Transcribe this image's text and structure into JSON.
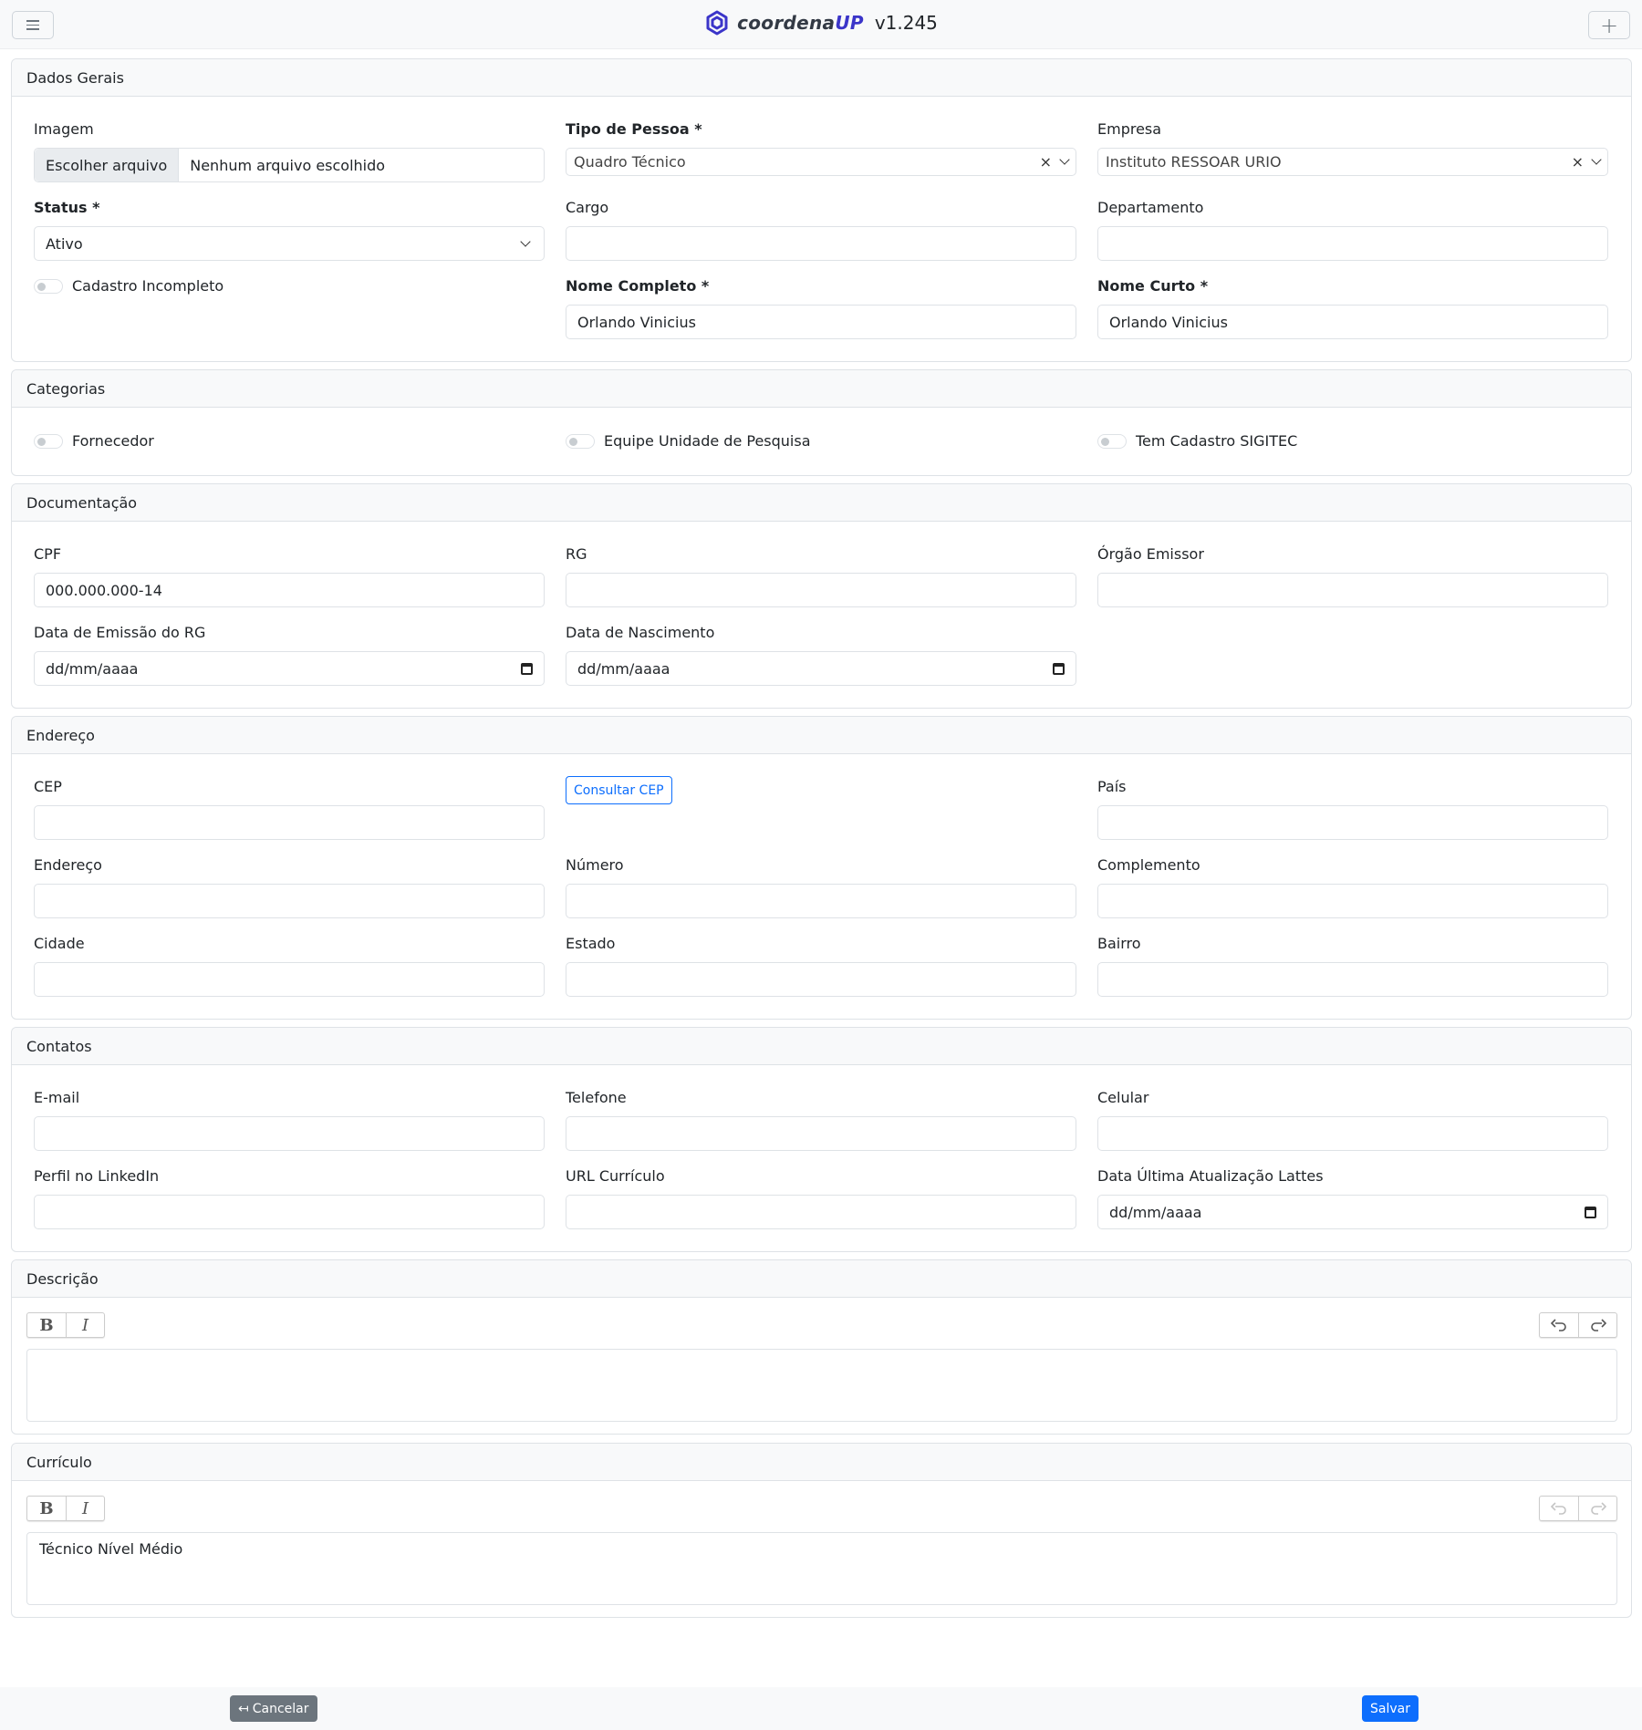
{
  "header": {
    "brand_name_prefix": "coordena",
    "brand_name_suffix": "UP",
    "version": "v1.245",
    "menu_icon": "hamburger-icon",
    "add_icon": "plus-icon",
    "add_label": "+"
  },
  "colors": {
    "brand": "#3b35c9",
    "primary": "#0d6efd",
    "secondary": "#6c757d"
  },
  "dados_gerais": {
    "title": "Dados Gerais",
    "imagem": {
      "label": "Imagem",
      "button": "Escolher arquivo",
      "value": "Nenhum arquivo escolhido"
    },
    "tipo_pessoa": {
      "label": "Tipo de Pessoa *",
      "value": "Quadro Técnico",
      "clear": "×"
    },
    "empresa": {
      "label": "Empresa",
      "value": "Instituto RESSOAR URIO",
      "clear": "×"
    },
    "status": {
      "label": "Status *",
      "value": "Ativo"
    },
    "cargo": {
      "label": "Cargo",
      "value": ""
    },
    "departamento": {
      "label": "Departamento",
      "value": ""
    },
    "cadastro_incompleto": {
      "label": "Cadastro Incompleto",
      "checked": false
    },
    "nome_completo": {
      "label": "Nome Completo *",
      "value": "Orlando Vinicius"
    },
    "nome_curto": {
      "label": "Nome Curto *",
      "value": "Orlando Vinicius"
    }
  },
  "categorias": {
    "title": "Categorias",
    "fornecedor": {
      "label": "Fornecedor",
      "checked": false
    },
    "equipe": {
      "label": "Equipe Unidade de Pesquisa",
      "checked": false
    },
    "sigitec": {
      "label": "Tem Cadastro SIGITEC",
      "checked": false
    }
  },
  "documentacao": {
    "title": "Documentação",
    "cpf": {
      "label": "CPF",
      "value": "000.000.000-14"
    },
    "rg": {
      "label": "RG",
      "value": ""
    },
    "orgao": {
      "label": "Órgão Emissor",
      "value": ""
    },
    "data_emissao": {
      "label": "Data de Emissão do RG",
      "value": "dd/mm/aaaa"
    },
    "data_nascimento": {
      "label": "Data de Nascimento",
      "value": "dd/mm/aaaa"
    }
  },
  "endereco": {
    "title": "Endereço",
    "cep": {
      "label": "CEP",
      "value": ""
    },
    "consultar": "Consultar CEP",
    "pais": {
      "label": "País",
      "value": ""
    },
    "endereco": {
      "label": "Endereço",
      "value": ""
    },
    "numero": {
      "label": "Número",
      "value": ""
    },
    "complemento": {
      "label": "Complemento",
      "value": ""
    },
    "cidade": {
      "label": "Cidade",
      "value": ""
    },
    "estado": {
      "label": "Estado",
      "value": ""
    },
    "bairro": {
      "label": "Bairro",
      "value": ""
    }
  },
  "contatos": {
    "title": "Contatos",
    "email": {
      "label": "E-mail",
      "value": ""
    },
    "telefone": {
      "label": "Telefone",
      "value": ""
    },
    "celular": {
      "label": "Celular",
      "value": ""
    },
    "linkedin": {
      "label": "Perfil no LinkedIn",
      "value": ""
    },
    "url_curriculo": {
      "label": "URL Currículo",
      "value": ""
    },
    "data_lattes": {
      "label": "Data Última Atualização Lattes",
      "value": "dd/mm/aaaa"
    }
  },
  "descricao": {
    "title": "Descrição",
    "bold": "B",
    "italic": "I",
    "content": ""
  },
  "curriculo": {
    "title": "Currículo",
    "bold": "B",
    "italic": "I",
    "content": "Técnico Nível Médio"
  },
  "footer": {
    "cancel": "Cancelar",
    "cancel_icon": "↤",
    "save": "Salvar"
  }
}
